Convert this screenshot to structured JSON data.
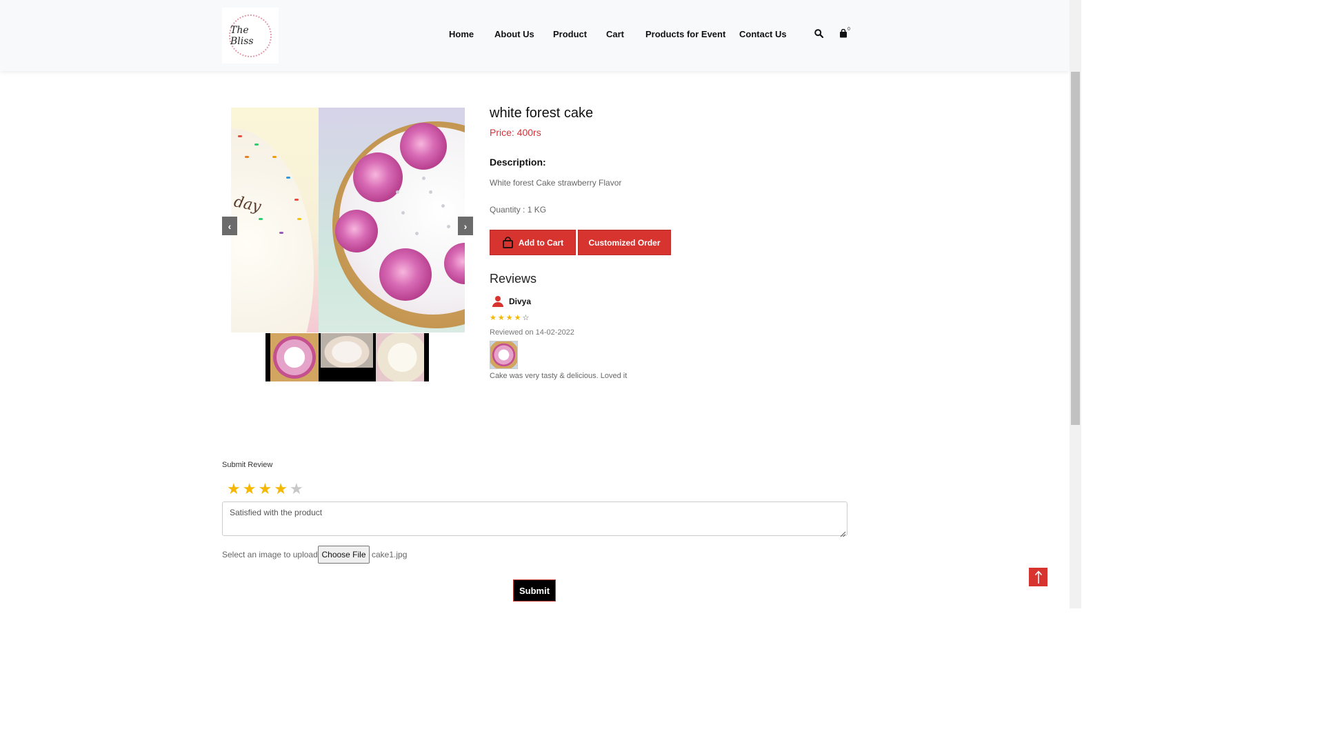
{
  "brand": {
    "logo_text": "The Bliss"
  },
  "nav": {
    "items": [
      {
        "label": "Home"
      },
      {
        "label": "About Us"
      },
      {
        "label": "Product"
      },
      {
        "label": "Cart"
      },
      {
        "label": "Products for Event"
      },
      {
        "label": "Contact Us"
      }
    ],
    "cart_count": "0",
    "icons": {
      "search": "search-icon",
      "cart": "shopping-bag-icon"
    }
  },
  "gallery": {
    "prev_icon": "chevron-left-icon",
    "next_icon": "chevron-right-icon",
    "thumbnail_count": 3
  },
  "product": {
    "title": "white forest cake",
    "price": "Price: 400rs",
    "description_heading": "Description:",
    "description": "White forest Cake strawberry Flavor",
    "quantity": "Quantity : 1 KG",
    "add_to_cart_label": "Add to Cart",
    "customized_order_label": "Customized Order"
  },
  "reviews": {
    "heading": "Reviews",
    "items": [
      {
        "name": "Divya",
        "rating": 4,
        "max_rating": 5,
        "reviewed_on": "Reviewed on 14-02-2022",
        "text": "Cake was very tasty & delicious. Loved it"
      }
    ]
  },
  "submit_review": {
    "heading": "Submit Review",
    "rating": 4,
    "max_rating": 5,
    "review_text": "Satisfied with the product",
    "upload_label": "Select an image to upload",
    "choose_file_label": "Choose File",
    "file_name": "cake1.jpg",
    "submit_label": "Submit"
  },
  "colors": {
    "accent_red": "#d7332f",
    "price_red": "#d0343a",
    "star_gold": "#f5b700",
    "star_empty": "#c8c8c8"
  }
}
